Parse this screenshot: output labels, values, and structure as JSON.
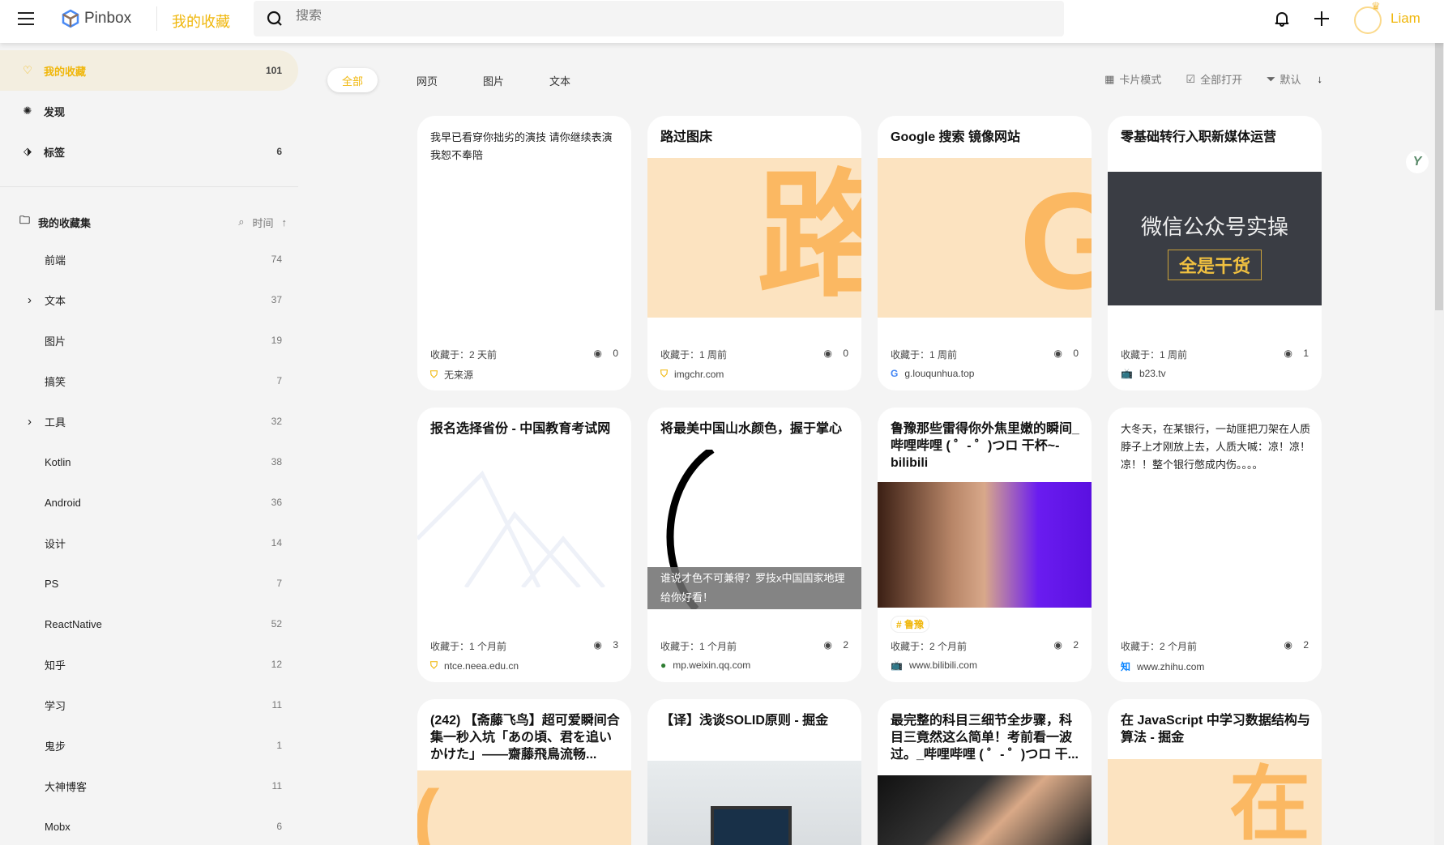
{
  "header": {
    "brand": "Pinbox",
    "title": "我的收藏",
    "search_placeholder": "搜索",
    "user": "Liam"
  },
  "sidebar": {
    "nav": [
      {
        "label": "我的收藏",
        "count": "101",
        "icon": "heart-icon"
      },
      {
        "label": "发现",
        "count": "",
        "icon": "discover-icon"
      },
      {
        "label": "标签",
        "count": "6",
        "icon": "tag-icon"
      }
    ],
    "collections_title": "我的收藏集",
    "sort_label": "时间",
    "collections": [
      {
        "label": "前端",
        "count": "74"
      },
      {
        "label": "文本",
        "count": "37",
        "expandable": true
      },
      {
        "label": "图片",
        "count": "19"
      },
      {
        "label": "搞笑",
        "count": "7"
      },
      {
        "label": "工具",
        "count": "32",
        "expandable": true
      },
      {
        "label": "Kotlin",
        "count": "38"
      },
      {
        "label": "Android",
        "count": "36"
      },
      {
        "label": "设计",
        "count": "14"
      },
      {
        "label": "PS",
        "count": "7"
      },
      {
        "label": "ReactNative",
        "count": "52"
      },
      {
        "label": "知乎",
        "count": "12"
      },
      {
        "label": "学习",
        "count": "11"
      },
      {
        "label": "鬼步",
        "count": "1"
      },
      {
        "label": "大神博客",
        "count": "11"
      },
      {
        "label": "Mobx",
        "count": "6"
      }
    ]
  },
  "tabs": [
    "全部",
    "网页",
    "图片",
    "文本"
  ],
  "toolbar": {
    "card_mode": "卡片模式",
    "open_all": "全部打开",
    "sort": "默认"
  },
  "cards": [
    {
      "text": "我早已看穿你拙劣的演技 请你继续表演 我恕不奉陪",
      "saved": "收藏于：2 天前",
      "views": "0",
      "source": "无来源",
      "src_icon": "bookmark"
    },
    {
      "title": "路过图床",
      "image": "letter",
      "letter": "路",
      "saved": "收藏于：1 周前",
      "views": "0",
      "source": "imgchr.com",
      "src_icon": "bookmark"
    },
    {
      "title": "Google 搜索 镜像网站",
      "image": "letter",
      "letter": "G",
      "saved": "收藏于：1 周前",
      "views": "0",
      "source": "g.louqunhua.top",
      "src_icon": "google"
    },
    {
      "title": "零基础转行入职新媒体运营",
      "image": "board",
      "board_line1": "微信公众号实操",
      "board_line2": "全是干货",
      "saved": "收藏于：1 周前",
      "views": "1",
      "source": "b23.tv",
      "src_icon": "bilibili"
    },
    {
      "title": "报名选择省份 - 中国教育考试网",
      "image": "mountains",
      "saved": "收藏于：1 个月前",
      "views": "3",
      "source": "ntce.neea.edu.cn",
      "src_icon": "bookmark"
    },
    {
      "title": "将最美中国山水颜色，握于掌心",
      "image": "ink",
      "caption": "谁说才色不可兼得？罗技x中国国家地理给你好看！",
      "saved": "收藏于：1 个月前",
      "views": "2",
      "source": "mp.weixin.qq.com",
      "src_icon": "wechat"
    },
    {
      "title": "鲁豫那些雷得你外焦里嫩的瞬间_哔哩哔哩 ( ゜- ゜)つロ 干杯~-bilibili",
      "image": "photo",
      "tag": "# 鲁豫",
      "saved": "收藏于：2 个月前",
      "views": "2",
      "source": "www.bilibili.com",
      "src_icon": "bilibili"
    },
    {
      "text": "大冬天，在某银行，一劫匪把刀架在人质脖子上才刚放上去，人质大喊：凉！凉！凉！！整个银行憋成内伤。。。。",
      "saved": "收藏于：2 个月前",
      "views": "2",
      "source": "www.zhihu.com",
      "src_icon": "zhihu"
    },
    {
      "title": "(242) 【斋藤飞鸟】超可爱瞬间合集一秒入坑「あの頃、君を追いかけた」——齋藤飛鳥流畅...",
      "image": "letter",
      "letter": "(",
      "saved": "",
      "views": "",
      "source": ""
    },
    {
      "title": "【译】浅谈SOLID原则 - 掘金",
      "image": "laptop",
      "saved": "",
      "views": "",
      "source": ""
    },
    {
      "title": "最完整的科目三细节全步骤，科目三竟然这么简单！考前看一波过。_哔哩哔哩 ( ゜- ゜)つロ 干...",
      "image": "car",
      "saved": "",
      "views": "",
      "source": ""
    },
    {
      "title": "在 JavaScript 中学习数据结构与算法 - 掘金",
      "image": "letter",
      "letter": "在",
      "saved": "",
      "views": "",
      "source": ""
    }
  ],
  "colors": {
    "accent": "#f0b70c",
    "active_bg": "#f3eee0",
    "placeholder_bg": "#fce3c0",
    "placeholder_fg": "#fbb862"
  }
}
